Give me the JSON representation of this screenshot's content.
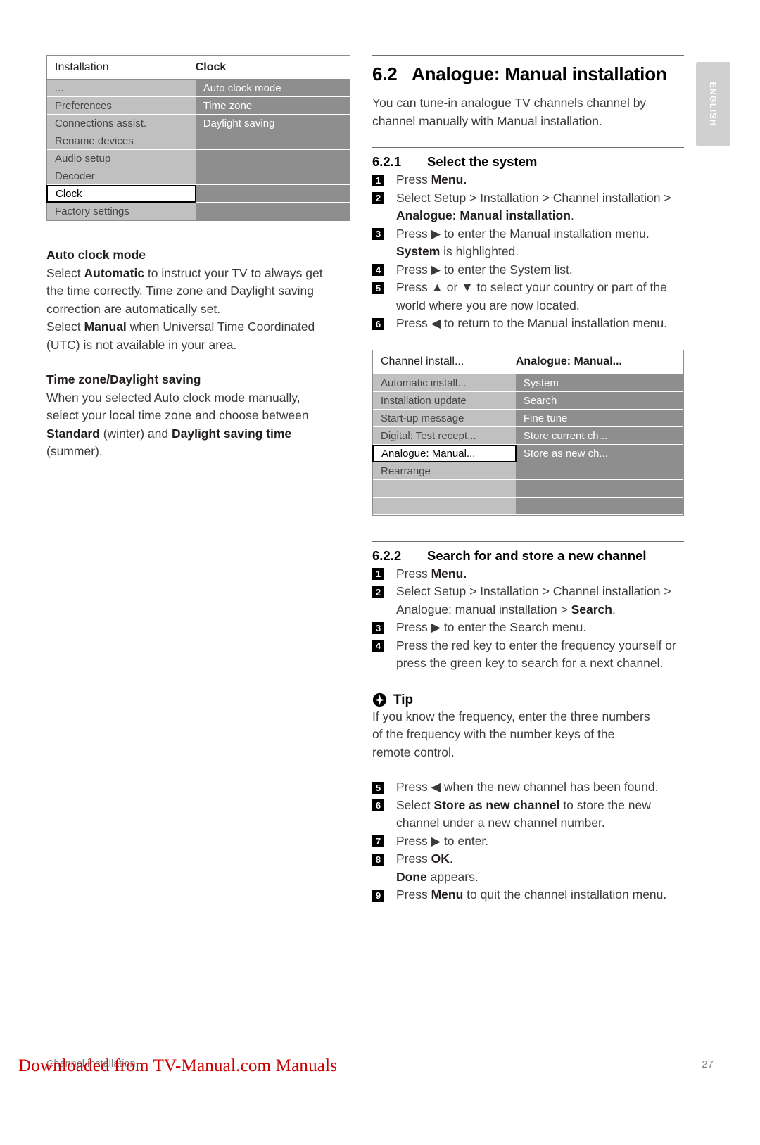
{
  "lang_tab": {
    "label": "ENGLISH"
  },
  "left_column": {
    "menu": {
      "header": {
        "left": "Installation",
        "right": "Clock"
      },
      "left_items": [
        "...",
        "Preferences",
        "Connections assist.",
        "Rename devices",
        "Audio setup",
        "Decoder",
        "Clock",
        "Factory settings"
      ],
      "selected_left_item": "Clock",
      "right_items": [
        "Auto clock mode",
        "Time zone",
        "Daylight saving",
        "",
        "",
        "",
        "",
        ""
      ]
    },
    "block1": {
      "heading": "Auto clock mode",
      "lines": [
        {
          "runs": [
            {
              "t": "Select ",
              "b": false
            },
            {
              "t": "Automatic",
              "b": true
            },
            {
              "t": " to instruct your TV to always get",
              "b": false
            }
          ]
        },
        {
          "runs": [
            {
              "t": "the time correctly. Time zone and Daylight saving",
              "b": false
            }
          ]
        },
        {
          "runs": [
            {
              "t": "correction are automatically set.",
              "b": false
            }
          ]
        },
        {
          "runs": [
            {
              "t": "Select ",
              "b": false
            },
            {
              "t": "Manual",
              "b": true
            },
            {
              "t": " when Universal Time Coordinated",
              "b": false
            }
          ]
        },
        {
          "runs": [
            {
              "t": "(UTC) is not available in your area.",
              "b": false
            }
          ]
        }
      ]
    },
    "block2": {
      "heading": "Time zone/Daylight saving",
      "lines": [
        {
          "runs": [
            {
              "t": "When you selected Auto clock mode manually,",
              "b": false
            }
          ]
        },
        {
          "runs": [
            {
              "t": "select your local time zone and choose between",
              "b": false
            }
          ]
        },
        {
          "runs": [
            {
              "t": "Standard",
              "b": true
            },
            {
              "t": " (winter) and ",
              "b": false
            },
            {
              "t": "Daylight saving time",
              "b": true
            }
          ]
        },
        {
          "runs": [
            {
              "t": "(summer).",
              "b": false
            }
          ]
        }
      ]
    }
  },
  "right_column": {
    "section": {
      "number": "6.2",
      "title": "Analogue: Manual installation",
      "intro_lines": [
        "You can tune-in analogue TV channels channel by",
        "channel manually with Manual installation."
      ]
    },
    "subsection_1": {
      "number": "6.2.1",
      "title": "Select the system",
      "steps": [
        {
          "n": "1",
          "runs": [
            {
              "t": "Press ",
              "b": false
            },
            {
              "t": "Menu.",
              "b": true
            }
          ]
        },
        {
          "n": "2",
          "runs": [
            {
              "t": "Select Setup > Installation > Channel installation > ",
              "b": false
            },
            {
              "t": "Analogue: Manual installation",
              "b": true
            },
            {
              "t": ".",
              "b": false
            }
          ]
        },
        {
          "n": "3",
          "runs": [
            {
              "t": "Press ▶ to enter the Manual installation menu. ",
              "b": false
            },
            {
              "t": "System",
              "b": true
            },
            {
              "t": " is highlighted.",
              "b": false
            }
          ]
        },
        {
          "n": "4",
          "runs": [
            {
              "t": "Press ▶ to enter the System list.",
              "b": false
            }
          ]
        },
        {
          "n": "5",
          "runs": [
            {
              "t": "Press ▲ or ▼ to select your country or part of the world where you are now located.",
              "b": false
            }
          ]
        },
        {
          "n": "6",
          "runs": [
            {
              "t": "Press ◀ to return to the Manual installation menu.",
              "b": false
            }
          ]
        }
      ]
    },
    "menu": {
      "header": {
        "left": "Channel install...",
        "right": "Analogue: Manual..."
      },
      "left_items": [
        "Automatic install...",
        "Installation update",
        "Start-up message",
        "Digital: Test recept...",
        "Analogue: Manual...",
        "Rearrange",
        "",
        ""
      ],
      "selected_left_item": "Analogue: Manual...",
      "right_items": [
        "System",
        "Search",
        "Fine tune",
        "Store current ch...",
        "Store as new ch...",
        "",
        "",
        ""
      ]
    },
    "subsection_2": {
      "number": "6.2.2",
      "title": "Search for and store a new channel",
      "steps_a": [
        {
          "n": "1",
          "runs": [
            {
              "t": "Press ",
              "b": false
            },
            {
              "t": "Menu.",
              "b": true
            }
          ]
        },
        {
          "n": "2",
          "runs": [
            {
              "t": "Select Setup > Installation > Channel installation > Analogue: manual installation > ",
              "b": false
            },
            {
              "t": "Search",
              "b": true
            },
            {
              "t": ".",
              "b": false
            }
          ]
        },
        {
          "n": "3",
          "runs": [
            {
              "t": "Press ▶ to enter the Search menu.",
              "b": false
            }
          ]
        },
        {
          "n": "4",
          "runs": [
            {
              "t": "Press the red key to enter the frequency yourself or press the green key to search for a next channel.",
              "b": false
            }
          ]
        }
      ],
      "tip": {
        "icon": "tip-star-icon",
        "label": "Tip",
        "lines": [
          "If you know the frequency, enter the three numbers",
          "of the frequency with the number keys of the",
          "remote control."
        ]
      },
      "steps_b": [
        {
          "n": "5",
          "runs": [
            {
              "t": "Press ◀ when the new channel has been found.",
              "b": false
            }
          ]
        },
        {
          "n": "6",
          "runs": [
            {
              "t": "Select ",
              "b": false
            },
            {
              "t": "Store as new channel",
              "b": true
            },
            {
              "t": " to store the new channel under a new channel number.",
              "b": false
            }
          ]
        },
        {
          "n": "7",
          "runs": [
            {
              "t": "Press ▶ to enter.",
              "b": false
            }
          ]
        },
        {
          "n": "8",
          "runs": [
            {
              "t": "Press ",
              "b": false
            },
            {
              "t": "OK",
              "b": true
            },
            {
              "t": ".",
              "b": false
            },
            {
              "t": "\n",
              "b": false
            }
          ]
        },
        {
          "n": "9",
          "runs": [
            {
              "t": "Press ",
              "b": false
            },
            {
              "t": "Menu",
              "b": true
            },
            {
              "t": " to quit the channel installation menu.",
              "b": false
            }
          ]
        }
      ],
      "step8_extra": {
        "runs": [
          {
            "t": "Done",
            "b": true
          },
          {
            "t": " appears.",
            "b": false
          }
        ]
      }
    }
  },
  "footer": {
    "left": "Channel installation",
    "page_number": "27",
    "watermark": "Downloaded from TV-Manual.com Manuals"
  },
  "colors": {
    "menu_left_pane": "#c0c0c0",
    "menu_right_pane": "#8e8e8e",
    "watermark_red": "#cc0000",
    "tab_grey": "#d0d0d0"
  }
}
